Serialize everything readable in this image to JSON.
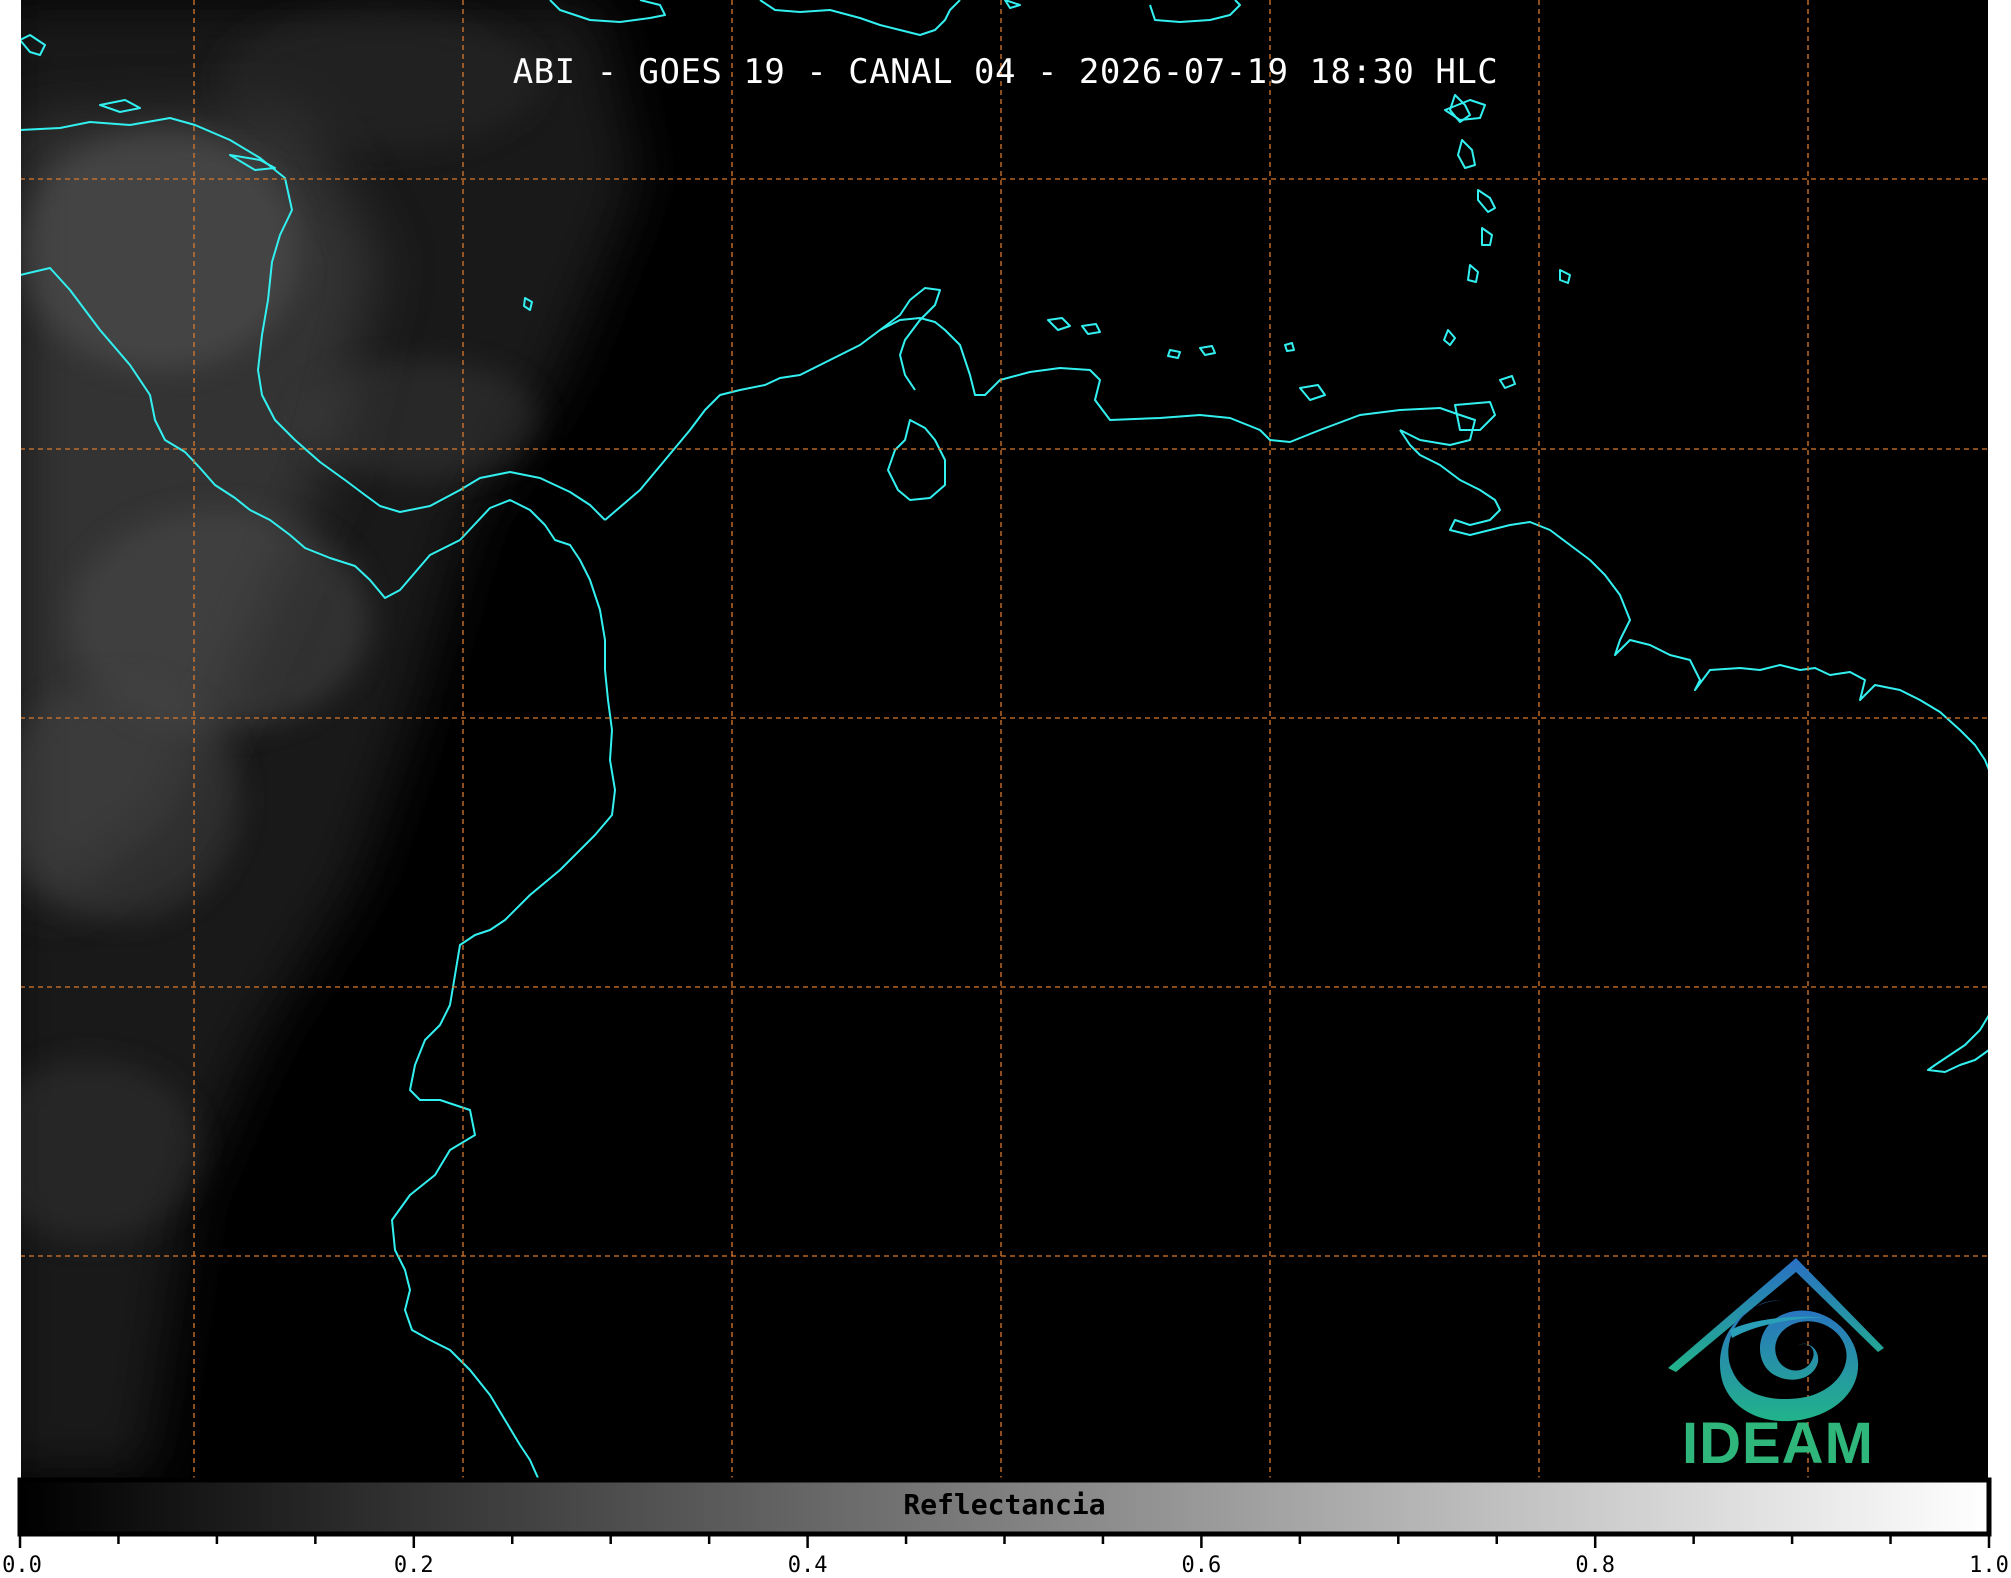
{
  "title": "ABI - GOES 19 - CANAL 04 - 2026-07-19 18:30 HLC",
  "logo": {
    "text": "IDEAM",
    "colors": {
      "mountain": "#2a7fbf",
      "swirl": "#1fa6a0",
      "text": "#2fb67a"
    }
  },
  "colorbar": {
    "label": "Reflectancia",
    "min": 0.0,
    "max": 1.0,
    "ticks": [
      "0.0",
      "0.2",
      "0.4",
      "0.6",
      "0.8",
      "1.0"
    ],
    "minor_step": 0.05,
    "colormap": "grayscale"
  },
  "map": {
    "coastline_color": "#33f0f0",
    "grid_color": "#d8782e",
    "grid_style": "dashed",
    "background": "#000000"
  }
}
